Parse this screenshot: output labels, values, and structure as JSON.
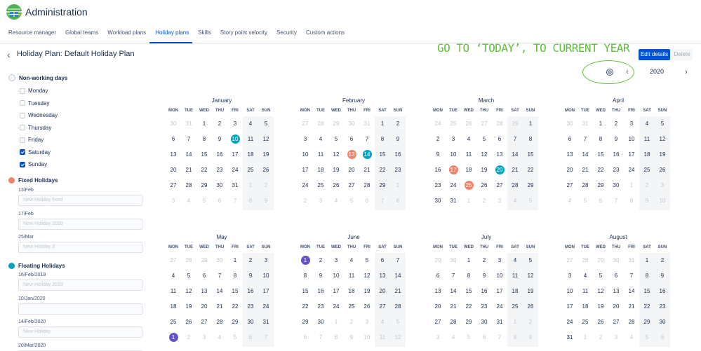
{
  "header": {
    "app_title": "Administration",
    "tabs": [
      {
        "label": "Resource manager",
        "active": false
      },
      {
        "label": "Global teams",
        "active": false
      },
      {
        "label": "Workload plans",
        "active": false
      },
      {
        "label": "Holiday plans",
        "active": true
      },
      {
        "label": "Skills",
        "active": false
      },
      {
        "label": "Story point velocity",
        "active": false
      },
      {
        "label": "Security",
        "active": false
      },
      {
        "label": "Custom actions",
        "active": false
      }
    ]
  },
  "page": {
    "title": "Holiday Plan: Default Holiday Plan",
    "edit_label": "Edit details",
    "delete_label": "Delete",
    "year": "2020"
  },
  "annotation": {
    "text": "GO TO ‘TODAY’, TO CURRENT YEAR",
    "color": "#5fbf3a"
  },
  "colors": {
    "fixed": "#f0846b",
    "floating": "#00a3bf",
    "special": "#6554c0",
    "accent": "#0052cc"
  },
  "sidebar": {
    "nonworking_label": "Non-working days",
    "days": [
      {
        "label": "Monday",
        "checked": false
      },
      {
        "label": "Tuesday",
        "checked": false
      },
      {
        "label": "Wednesday",
        "checked": false
      },
      {
        "label": "Thursday",
        "checked": false
      },
      {
        "label": "Friday",
        "checked": false
      },
      {
        "label": "Saturday",
        "checked": true
      },
      {
        "label": "Sunday",
        "checked": true
      }
    ],
    "fixed_label": "Fixed Holidays",
    "fixed": [
      {
        "date": "13/Feb",
        "placeholder": "New Holiday fixed"
      },
      {
        "date": "17/Feb",
        "placeholder": "New Holiday 2019"
      },
      {
        "date": "25/Mar",
        "placeholder": "New Holiday 3"
      }
    ],
    "floating_label": "Floating Holidays",
    "floating": [
      {
        "date": "16/Feb/2019",
        "placeholder": "New Holiday 2019"
      },
      {
        "date": "10/Jan/2020",
        "placeholder": ""
      },
      {
        "date": "14/Feb/2020",
        "placeholder": "New Holiday"
      },
      {
        "date": "20/Mar/2020",
        "placeholder": ""
      }
    ]
  },
  "calendar": {
    "weekdays": [
      "MON",
      "TUE",
      "WED",
      "THU",
      "FRI",
      "SAT",
      "SUN"
    ],
    "months": [
      {
        "name": "January",
        "start": 2,
        "days": 31,
        "prev_days": 31,
        "highlights": {
          "10": "floating"
        }
      },
      {
        "name": "February",
        "start": 5,
        "days": 29,
        "prev_days": 31,
        "highlights": {
          "13": "fixed",
          "14": "floating"
        }
      },
      {
        "name": "March",
        "start": 6,
        "days": 31,
        "prev_days": 29,
        "highlights": {
          "17": "fixed",
          "20": "floating",
          "25": "fixed"
        }
      },
      {
        "name": "April",
        "start": 2,
        "days": 30,
        "prev_days": 31,
        "highlights": {}
      },
      {
        "name": "May",
        "start": 4,
        "days": 31,
        "prev_days": 30,
        "highlights": {}
      },
      {
        "name": "June",
        "start": 0,
        "days": 30,
        "prev_days": 31,
        "highlights": {
          "1": "special"
        }
      },
      {
        "name": "July",
        "start": 2,
        "days": 31,
        "prev_days": 30,
        "highlights": {}
      },
      {
        "name": "August",
        "start": 5,
        "days": 31,
        "prev_days": 31,
        "highlights": {}
      }
    ],
    "extra_highlights": [
      {
        "month_index": 4,
        "day": 1,
        "type": "special"
      }
    ]
  }
}
